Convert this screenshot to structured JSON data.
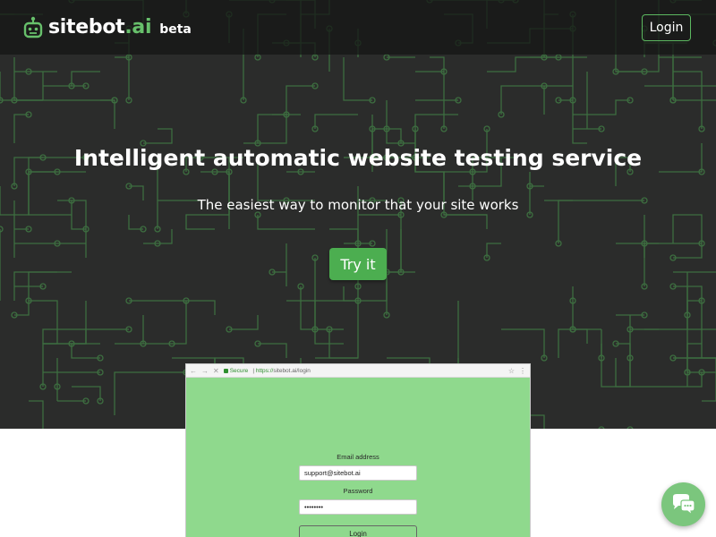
{
  "colors": {
    "hero_background": "#2b2c2b",
    "circuit_trace": "#3d6e40",
    "accent_green": "#4cae50",
    "brand_tld": "#67c06b",
    "mockup_background": "#8fd98d",
    "chat_bubble": "#7bc67d"
  },
  "navbar": {
    "brand_name": "sitebot",
    "brand_tld": ".ai",
    "brand_tag": "beta",
    "brand_icon": "robot-icon",
    "login_label": "Login"
  },
  "hero": {
    "title": "Intelligent automatic website testing service",
    "subtitle": "The easiest way to monitor that your site works",
    "cta_label": "Try it"
  },
  "mockup": {
    "chrome": {
      "secure_label": "Secure",
      "url_scheme": "https://",
      "url_rest": "sitebot.ai/login",
      "star_icon": "star-icon",
      "menu_icon": "kebab-menu-icon"
    },
    "form": {
      "email_label": "Email address",
      "email_value": "support@sitebot.ai",
      "password_label": "Password",
      "password_value": "••••••••",
      "login_label": "Login"
    }
  },
  "chat": {
    "icon": "chat-bubbles-icon"
  }
}
